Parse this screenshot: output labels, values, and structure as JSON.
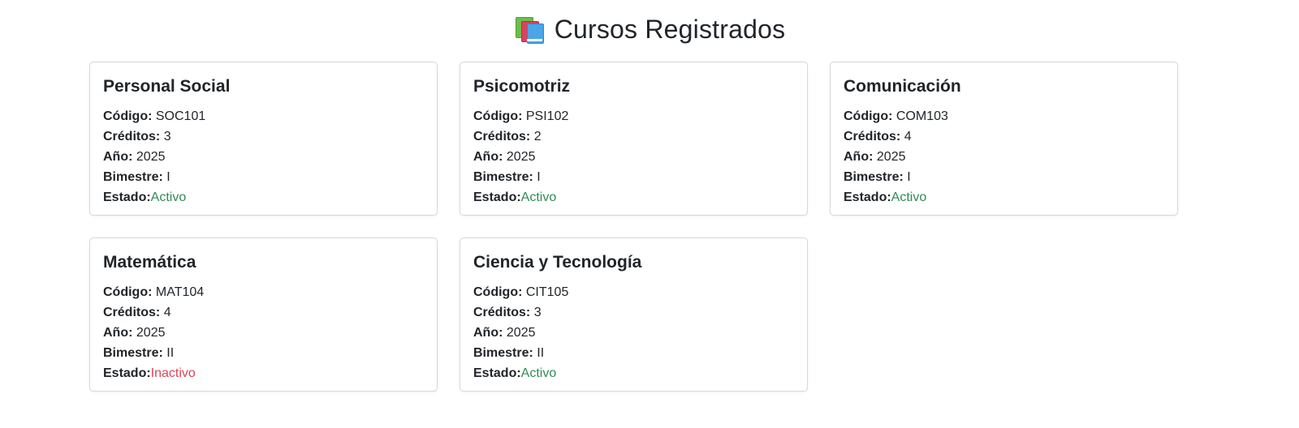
{
  "header": {
    "icon": "books-icon",
    "title": "Cursos Registrados"
  },
  "labels": {
    "codigo": "Código:",
    "creditos": "Créditos:",
    "anio": "Año:",
    "bimestre": "Bimestre:",
    "estado": "Estado:"
  },
  "colors": {
    "activo": "#2e8b57",
    "inactivo": "#d9465a"
  },
  "courses": [
    {
      "name": "Personal Social",
      "codigo": "SOC101",
      "creditos": "3",
      "anio": "2025",
      "bimestre": "I",
      "estado": "Activo"
    },
    {
      "name": "Psicomotriz",
      "codigo": "PSI102",
      "creditos": "2",
      "anio": "2025",
      "bimestre": "I",
      "estado": "Activo"
    },
    {
      "name": "Comunicación",
      "codigo": "COM103",
      "creditos": "4",
      "anio": "2025",
      "bimestre": "I",
      "estado": "Activo"
    },
    {
      "name": "Matemática",
      "codigo": "MAT104",
      "creditos": "4",
      "anio": "2025",
      "bimestre": "II",
      "estado": "Inactivo"
    },
    {
      "name": "Ciencia y Tecnología",
      "codigo": "CIT105",
      "creditos": "3",
      "anio": "2025",
      "bimestre": "II",
      "estado": "Activo"
    }
  ]
}
